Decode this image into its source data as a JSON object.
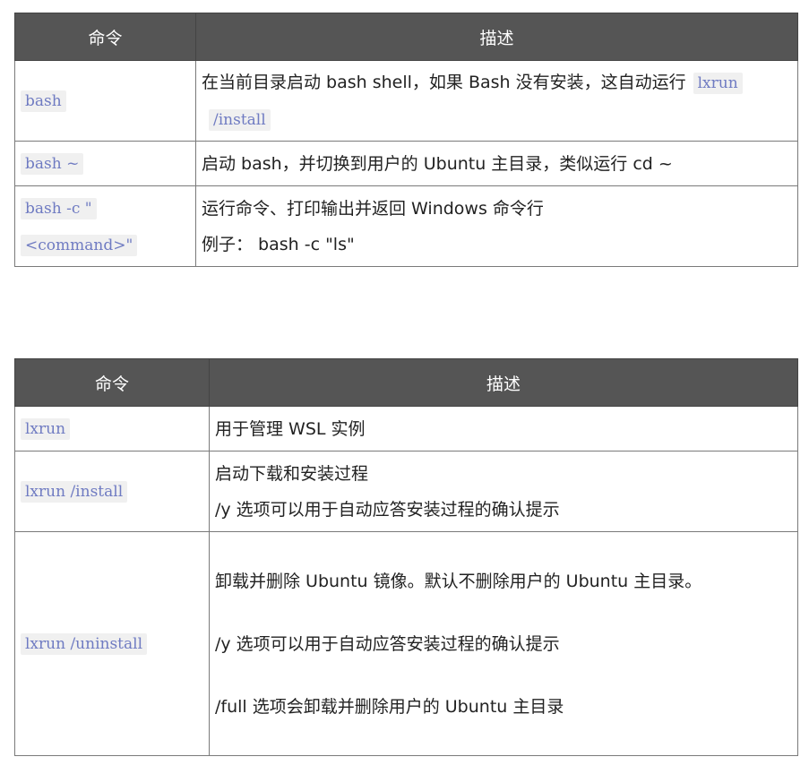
{
  "table1": {
    "header": {
      "col1": "命令",
      "col2": "描述"
    },
    "rows": [
      {
        "cmd": "bash",
        "desc": "在当前目录启动 bash shell，如果 Bash 没有安装，这自动运行",
        "desc_code": "lxrun /install"
      },
      {
        "cmd": "bash ~",
        "desc": "启动 bash，并切换到用户的 Ubuntu 主目录，类似运行 cd ~"
      },
      {
        "cmd": "bash -c \"<command>\"",
        "desc": "运行命令、打印输出并返回 Windows 命令行",
        "desc2": "例子： bash -c \"ls\""
      }
    ]
  },
  "table2": {
    "header": {
      "col1": "命令",
      "col2": "描述"
    },
    "rows": [
      {
        "cmd": "lxrun",
        "desc": "用于管理 WSL 实例"
      },
      {
        "cmd": "lxrun /install",
        "desc": "启动下载和安装过程",
        "desc2": "/y 选项可以用于自动应答安装过程的确认提示"
      },
      {
        "cmd": "lxrun /uninstall",
        "desc": "卸载并删除 Ubuntu 镜像。默认不删除用户的 Ubuntu 主目录。",
        "desc2": "/y 选项可以用于自动应答安装过程的确认提示",
        "desc3": "/full 选项会卸载并删除用户的 Ubuntu 主目录"
      }
    ]
  }
}
